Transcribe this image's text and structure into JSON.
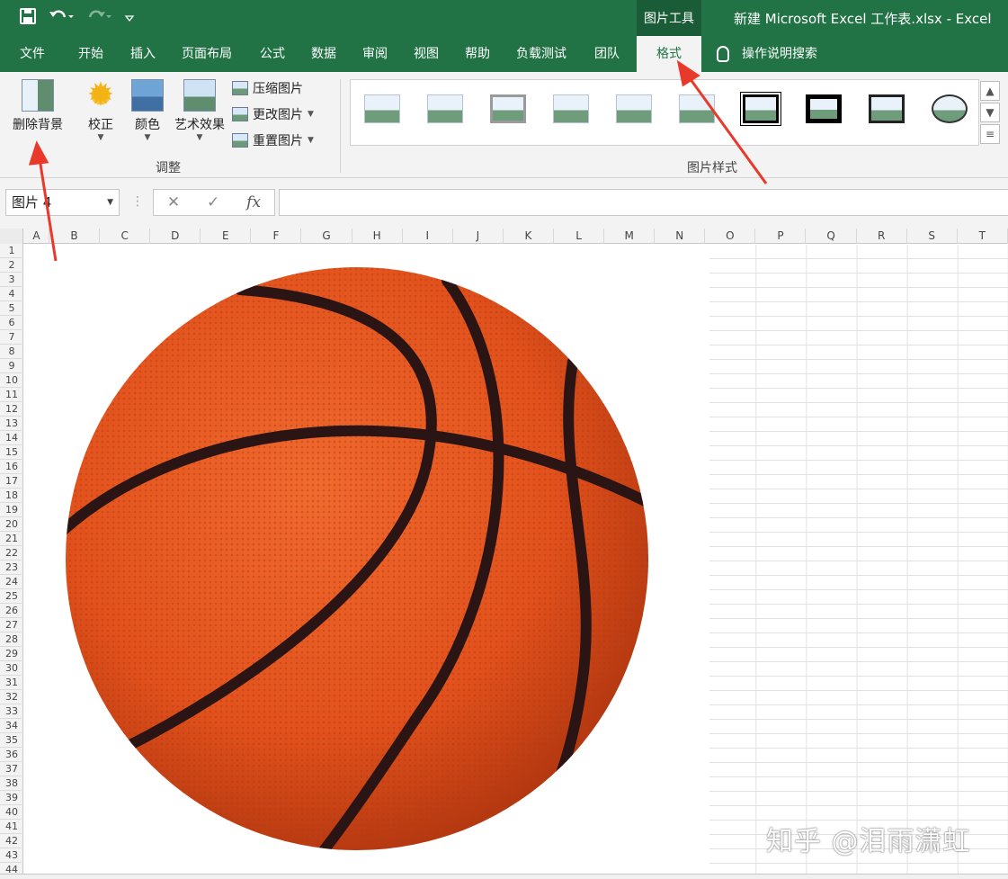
{
  "title_bar": {
    "save_icon": "save-icon",
    "undo_icon": "undo-icon",
    "redo_icon": "redo-icon",
    "customize_icon": "customize-qat-icon",
    "context_group": "图片工具",
    "document_title": "新建 Microsoft Excel 工作表.xlsx  -  Excel"
  },
  "tabs": [
    {
      "label": "文件"
    },
    {
      "label": "开始"
    },
    {
      "label": "插入"
    },
    {
      "label": "页面布局"
    },
    {
      "label": "公式"
    },
    {
      "label": "数据"
    },
    {
      "label": "审阅"
    },
    {
      "label": "视图"
    },
    {
      "label": "帮助"
    },
    {
      "label": "负载测试"
    },
    {
      "label": "团队"
    },
    {
      "label": "格式",
      "active": true
    }
  ],
  "tell_me": {
    "label": "操作说明搜索",
    "icon": "lightbulb-icon"
  },
  "ribbon": {
    "remove_background": "删除背景",
    "corrections": "校正",
    "color": "颜色",
    "artistic_effects": "艺术效果",
    "compress_pictures": "压缩图片",
    "change_picture": "更改图片",
    "reset_picture": "重置图片",
    "adjust_group": "调整",
    "styles_group": "图片样式"
  },
  "formula_bar": {
    "name_box": "图片 4",
    "cancel_icon": "✕",
    "enter_icon": "✓",
    "fx_label": "fx",
    "formula": ""
  },
  "grid": {
    "columns": [
      "A",
      "B",
      "C",
      "D",
      "E",
      "F",
      "G",
      "H",
      "I",
      "J",
      "K",
      "L",
      "M",
      "N",
      "O",
      "P",
      "Q",
      "R",
      "S",
      "T"
    ],
    "rows": [
      "1",
      "2",
      "3",
      "4",
      "5",
      "6",
      "7",
      "8",
      "9",
      "10",
      "11",
      "12",
      "13",
      "14",
      "15",
      "16",
      "17",
      "18",
      "19",
      "20",
      "21",
      "22",
      "23",
      "24",
      "25",
      "26",
      "27",
      "28",
      "29",
      "30",
      "31",
      "32",
      "33",
      "34",
      "35",
      "36",
      "37",
      "38",
      "39",
      "40",
      "41",
      "42",
      "43",
      "44"
    ]
  },
  "picture": {
    "subject": "basketball-image",
    "colors": {
      "ball": "#e2511c",
      "seam": "#2a1414"
    }
  },
  "watermark": "知乎 @泪雨潇虹",
  "annotations": {
    "arrow_color": "#e8392b"
  },
  "colors": {
    "excel_green": "#217346",
    "ribbon_bg": "#f3f3f3"
  }
}
